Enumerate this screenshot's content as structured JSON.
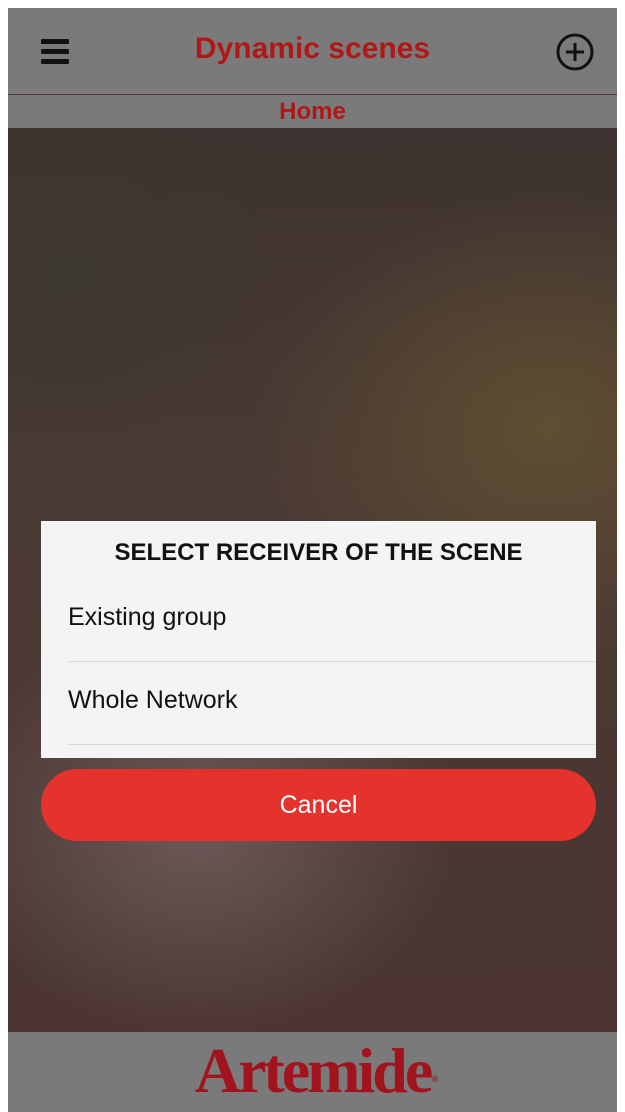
{
  "header": {
    "title": "Dynamic scenes",
    "menu_icon": "hamburger-menu-icon",
    "add_icon": "plus-circle-icon"
  },
  "subheader": {
    "label": "Home"
  },
  "dialog": {
    "title": "SELECT RECEIVER OF THE SCENE",
    "options": [
      {
        "label": "Existing group"
      },
      {
        "label": "Whole Network"
      }
    ],
    "cancel_label": "Cancel"
  },
  "footer": {
    "logo_text": "Artemide",
    "logo_mark": "®"
  },
  "colors": {
    "bar_background": "#7a7a7a",
    "title_red": "#b01818",
    "cancel_red": "#e4322d",
    "logo_red": "#a2141d",
    "dialog_background": "#f4f4f4"
  }
}
